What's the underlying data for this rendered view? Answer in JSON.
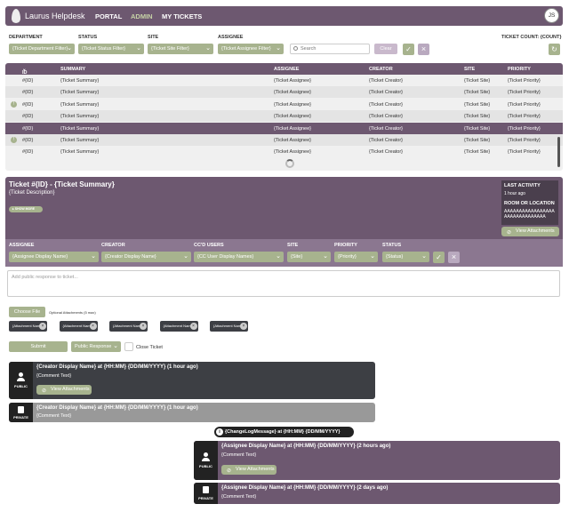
{
  "nav": {
    "brand": "Laurus Helpdesk",
    "links": [
      "PORTAL",
      "ADMIN",
      "MY TICKETS"
    ],
    "active": "ADMIN",
    "avatar": "JS"
  },
  "filters": {
    "department_label": "DEPARTMENT",
    "department_value": "{Ticket Department Filter}",
    "status_label": "STATUS",
    "status_value": "{Ticket Status Filter}",
    "site_label": "SITE",
    "site_value": "{Ticket Site Filter}",
    "assignee_label": "ASSIGNEE",
    "assignee_value": "{Ticket Assignee Filter}",
    "search_placeholder": "Search",
    "clear_label": "Clear",
    "count_label": "TICKET COUNT: {COUNT}"
  },
  "table": {
    "headers": [
      "ID",
      "SUMMARY",
      "ASSIGNEE",
      "CREATOR",
      "SITE",
      "PRIORITY"
    ],
    "rows": [
      {
        "id": "#{ID}",
        "summary": "{Ticket Summary}",
        "assignee": "{Ticket Assignee}",
        "creator": "{Ticket Creator}",
        "site": "{Ticket Site}",
        "priority": "{Ticket Priority}",
        "warn": false
      },
      {
        "id": "#{ID}",
        "summary": "{Ticket Summary}",
        "assignee": "{Ticket Assignee}",
        "creator": "{Ticket Creator}",
        "site": "{Ticket Site}",
        "priority": "{Ticket Priority}",
        "warn": false
      },
      {
        "id": "#{ID}",
        "summary": "{Ticket Summary}",
        "assignee": "{Ticket Assignee}",
        "creator": "{Ticket Creator}",
        "site": "{Ticket Site}",
        "priority": "{Ticket Priority}",
        "warn": true
      },
      {
        "id": "#{ID}",
        "summary": "{Ticket Summary}",
        "assignee": "{Ticket Assignee}",
        "creator": "{Ticket Creator}",
        "site": "{Ticket Site}",
        "priority": "{Ticket Priority}",
        "warn": false
      },
      {
        "id": "#{ID}",
        "summary": "{Ticket Summary}",
        "assignee": "{Ticket Assignee}",
        "creator": "{Ticket Creator}",
        "site": "{Ticket Site}",
        "priority": "{Ticket Priority}",
        "warn": false
      },
      {
        "id": "#{ID}",
        "summary": "{Ticket Summary}",
        "assignee": "{Ticket Assignee}",
        "creator": "{Ticket Creator}",
        "site": "{Ticket Site}",
        "priority": "{Ticket Priority}",
        "warn": true
      },
      {
        "id": "#{ID}",
        "summary": "{Ticket Summary}",
        "assignee": "{Ticket Assignee}",
        "creator": "{Ticket Creator}",
        "site": "{Ticket Site}",
        "priority": "{Ticket Priority}",
        "warn": false
      }
    ]
  },
  "ticket": {
    "title": "Ticket #{ID} - {Ticket Summary}",
    "description": "{Ticket Description}",
    "show_more": "SHOW MORE",
    "last_activity_label": "LAST ACTIVITY",
    "last_activity_value": "1 hour ago",
    "room_label": "ROOM OR LOCATION",
    "room_value": "AAAAAAAAAAAAAAAAAAAAAAAAAAAAAAA",
    "view_attachments": "View Attachments",
    "fields": {
      "assignee_label": "ASSIGNEE",
      "assignee_value": "{Assignee Display Name}",
      "creator_label": "CREATOR",
      "creator_value": "{Creator Display Name}",
      "cc_label": "CC'D USERS",
      "cc_value": "{CC User Display Names}",
      "site_label": "SITE",
      "site_value": "{Site}",
      "priority_label": "PRIORITY",
      "priority_value": "{Priority}",
      "status_label": "STATUS",
      "status_value": "{Status}"
    }
  },
  "reply": {
    "placeholder": "Add public response to ticket...",
    "choose_file": "Choose File",
    "optional_attachments": "Optional Attachments (5 max)",
    "attachments": [
      "{Attachment Name}",
      "{Attachment Name}",
      "{Attachment Name}",
      "{Attachment Name}",
      "{Attachment Name}"
    ],
    "submit": "Submit",
    "response_type": "Public Response",
    "close_ticket": "Close Ticket"
  },
  "comments": [
    {
      "title": "{Creator Display Name} at {HH:MM} {DD/MM/YYYY} (1 hour ago)",
      "text": "{Comment Text}",
      "visibility": "PUBLIC",
      "attachments": "View Attachments"
    },
    {
      "title": "{Creator Display Name} at {HH:MM} {DD/MM/YYYY} (1 hour ago)",
      "text": "{Comment Text}",
      "visibility": "PRIVATE"
    },
    {
      "title": "{Assignee Display Name} at {HH:MM} {DD/MM/YYYY} (2 hours ago)",
      "text": "{Comment Text}",
      "visibility": "PUBLIC",
      "attachments": "View Attachments"
    },
    {
      "title": "{Assignee Display Name} at {HH:MM} {DD/MM/YYYY} (2 days ago)",
      "text": "{Comment Text}",
      "visibility": "PRIVATE"
    }
  ],
  "changelog": "{ChangeLogMessage} at {HH:MM} {DD/MM/YYYY}",
  "colors": {
    "primary": "#6d5870",
    "accent": "#a7b38e",
    "dark": "#3d3f44"
  }
}
